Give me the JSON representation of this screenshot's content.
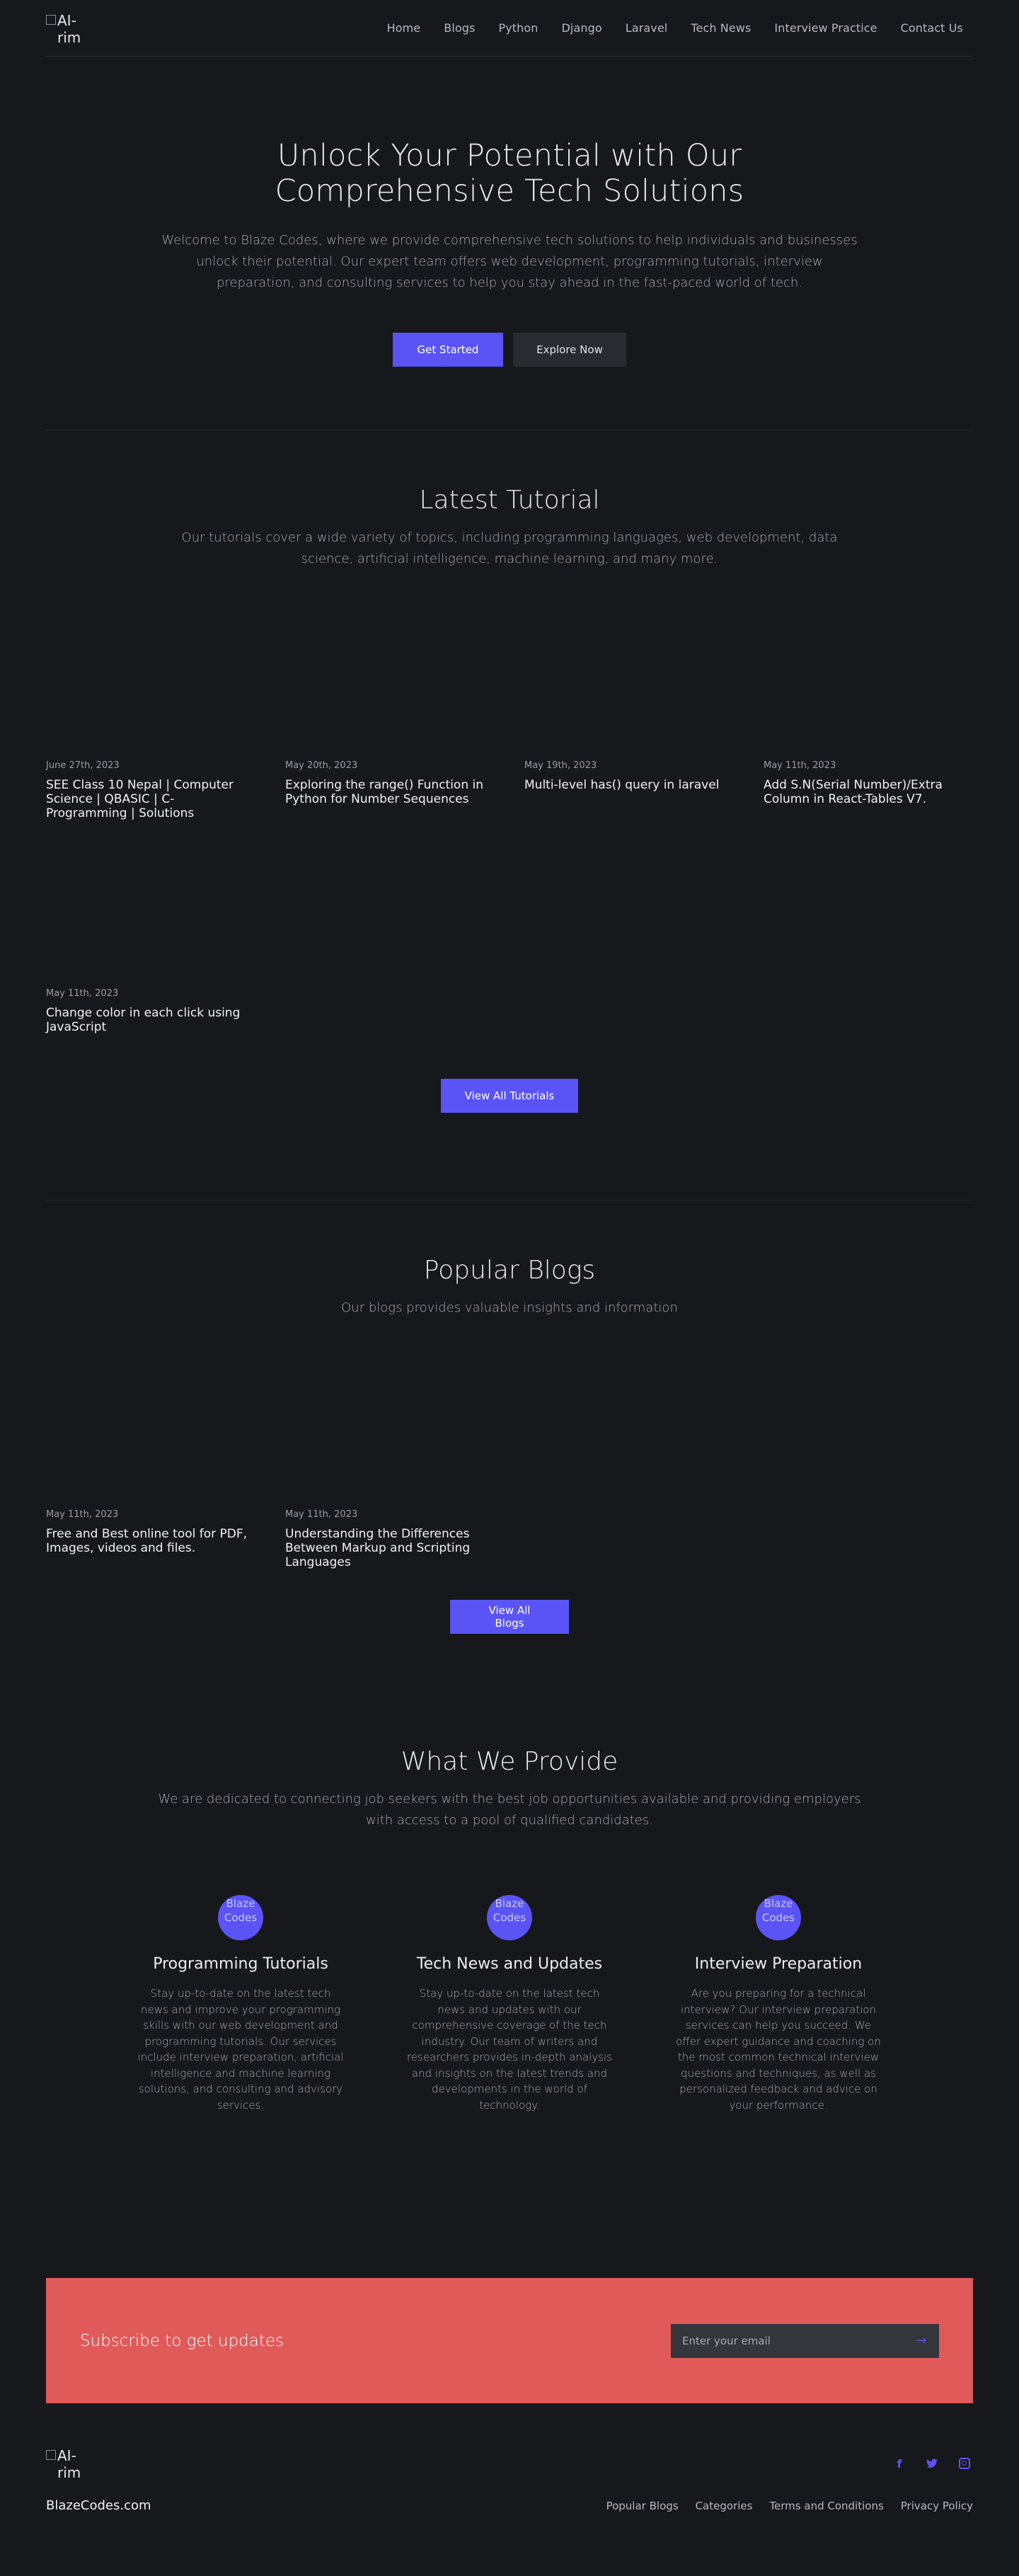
{
  "header": {
    "logo_alt": "AI-rim",
    "nav": [
      "Home",
      "Blogs",
      "Python",
      "Django",
      "Laravel",
      "Tech News",
      "Interview Practice",
      "Contact Us"
    ]
  },
  "hero": {
    "title": "Unlock Your Potential with Our Comprehensive Tech Solutions",
    "text": "Welcome to Blaze Codes, where we provide comprehensive tech solutions to help individuals and businesses unlock their potential. Our expert team offers web development, programming tutorials, interview preparation, and consulting services to help you stay ahead in the fast-paced world of tech.",
    "primary_label": "Get Started",
    "secondary_label": "Explore Now"
  },
  "tutorials": {
    "title": "Latest Tutorial",
    "lead": "Our tutorials cover a wide variety of topics, including programming languages, web development, data science, artificial intelligence, machine learning, and many more.",
    "items": [
      {
        "date": "June 27th, 2023",
        "title": "SEE Class 10 Nepal | Computer Science | QBASIC | C-Programming | Solutions"
      },
      {
        "date": "May 20th, 2023",
        "title": "Exploring the range() Function in Python for Number Sequences"
      },
      {
        "date": "May 19th, 2023",
        "title": "Multi-level has() query in laravel"
      },
      {
        "date": "May 11th, 2023",
        "title": "Add S.N(Serial Number)/Extra Column in React-Tables V7."
      },
      {
        "date": "May 11th, 2023",
        "title": "Change color in each click using JavaScript"
      }
    ],
    "button_label": "View All Tutorials"
  },
  "blogs": {
    "title": "Popular Blogs",
    "lead": "Our blogs provides valuable insights and information",
    "items": [
      {
        "date": "May 11th, 2023",
        "title": "Free and Best online tool for PDF, Images, videos and files."
      },
      {
        "date": "May 11th, 2023",
        "title": "Understanding the Differences Between Markup and Scripting Languages"
      }
    ],
    "button_label": "View All Blogs"
  },
  "provide": {
    "title": "What We Provide",
    "lead": "We are dedicated to connecting job seekers with the best job opportunities available and providing employers with access to a pool of qualified candidates.",
    "icon_alt": "Blaze Codes",
    "items": [
      {
        "title": "Programming Tutorials",
        "text": "Stay up-to-date on the latest tech news and improve your programming skills with our web development and programming tutorials. Our services include interview preparation, artificial intelligence and machine learning solutions, and consulting and advisory services."
      },
      {
        "title": "Tech News and Updates",
        "text": "Stay up-to-date on the latest tech news and updates with our comprehensive coverage of the tech industry. Our team of writers and researchers provides in-depth analysis and insights on the latest trends and developments in the world of technology."
      },
      {
        "title": "Interview Preparation",
        "text": "Are you preparing for a technical interview? Our interview preparation services can help you succeed. We offer expert guidance and coaching on the most common technical interview questions and techniques, as well as personalized feedback and advice on your performance."
      }
    ]
  },
  "subscribe": {
    "title": "Subscribe to get updates",
    "placeholder": "Enter your email"
  },
  "footer": {
    "logo_alt": "AI-rim",
    "brand": "BlazeCodes.com",
    "links": [
      "Popular Blogs",
      "Categories",
      "Terms and Conditions",
      "Privacy Policy"
    ],
    "socials": [
      "facebook-icon",
      "twitter-icon",
      "instagram-icon"
    ]
  },
  "colors": {
    "background": "#17181b",
    "accent": "#5a54f7",
    "subscribe_bg": "#e05a5a"
  }
}
